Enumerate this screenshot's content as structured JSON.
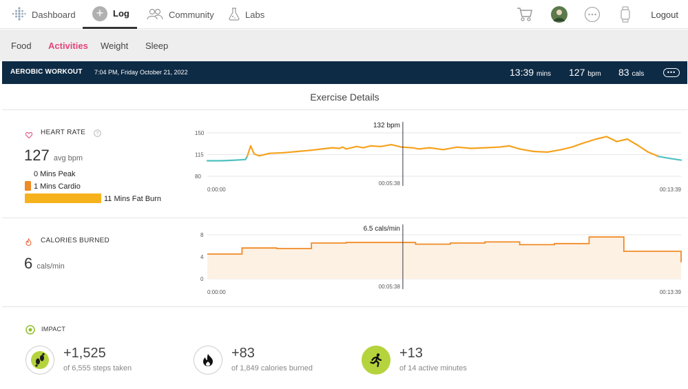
{
  "nav": {
    "dashboard": "Dashboard",
    "log": "Log",
    "community": "Community",
    "labs": "Labs",
    "logout": "Logout",
    "log_icon_glyph": "+"
  },
  "subnav": {
    "items": [
      "Food",
      "Activities",
      "Weight",
      "Sleep"
    ],
    "active": "Activities"
  },
  "workout": {
    "title": "AEROBIC WORKOUT",
    "datetime": "7:04 PM, Friday October 21, 2022",
    "duration_value": "13:39",
    "duration_unit": "mins",
    "bpm_value": "127",
    "bpm_unit": "bpm",
    "cals_value": "83",
    "cals_unit": "cals"
  },
  "section_title": "Exercise Details",
  "heart_rate": {
    "label": "HEART RATE",
    "avg_value": "127",
    "avg_unit": "avg bpm",
    "zones": [
      {
        "text": "0 Mins Peak",
        "minutes": 0
      },
      {
        "text": "1 Mins Cardio",
        "minutes": 1
      },
      {
        "text": "11 Mins Fat Burn",
        "minutes": 11
      }
    ]
  },
  "calories": {
    "label": "CALORIES BURNED",
    "value": "6",
    "unit": "cals/min"
  },
  "impact": {
    "label": "IMPACT",
    "items": [
      {
        "main": "+1,525",
        "sub": "of 6,555 steps taken",
        "icon": "footsteps-icon"
      },
      {
        "main": "+83",
        "sub": "of 1,849 calories burned",
        "icon": "flame-icon"
      },
      {
        "main": "+13",
        "sub": "of 14 active minutes",
        "icon": "runner-icon"
      }
    ]
  },
  "colors": {
    "accent": "#e2437a",
    "header_bg": "#0e2b45",
    "hr_orange": "#f6a21d",
    "hr_teal": "#4fc1c0",
    "cal_orange": "#f08a24",
    "impact_green": "#b5d33d"
  },
  "chart_data": [
    {
      "type": "line",
      "title": "",
      "y_ticks": [
        "150",
        "115",
        "80"
      ],
      "ylim": [
        80,
        150
      ],
      "x_start_label": "0:00:00",
      "x_end_label": "0:00:13:39",
      "x_end_display": "00:13:39",
      "marker_time": "00:05:38",
      "marker_value_label": "132 bpm",
      "x_minutes": [
        0,
        0.4,
        0.8,
        1.1,
        1.15,
        1.25,
        1.35,
        1.5,
        1.8,
        2.2,
        2.6,
        3.0,
        3.3,
        3.6,
        3.8,
        3.9,
        4.0,
        4.3,
        4.5,
        4.7,
        5.0,
        5.3,
        5.6,
        5.9,
        6.1,
        6.4,
        6.8,
        7.2,
        7.6,
        8.0,
        8.4,
        8.7,
        9.0,
        9.4,
        9.8,
        10.2,
        10.5,
        10.8,
        11.2,
        11.5,
        11.8,
        12.1,
        12.4,
        12.7,
        13.0,
        13.3,
        13.65
      ],
      "y_bpm": [
        105,
        105,
        106,
        107,
        112,
        129,
        116,
        113,
        117,
        118,
        120,
        122,
        124,
        126,
        125,
        127,
        124,
        128,
        126,
        129,
        128,
        131,
        127,
        126,
        124,
        126,
        123,
        127,
        125,
        126,
        127,
        129,
        124,
        120,
        119,
        123,
        127,
        133,
        140,
        144,
        136,
        140,
        130,
        119,
        112,
        109,
        106
      ]
    },
    {
      "type": "area",
      "title": "",
      "y_ticks": [
        "8",
        "4",
        "0"
      ],
      "ylim": [
        0,
        8
      ],
      "x_start_label": "0:00:00",
      "x_end_label": "00:13:39",
      "marker_time": "00:05:38",
      "marker_value_label": "6.5 cals/min",
      "steps_minutes": [
        0,
        1,
        2,
        3,
        4,
        5,
        6,
        7,
        8,
        9,
        10,
        11,
        12,
        13,
        13.65
      ],
      "steps_cals": [
        4.5,
        5.6,
        5.5,
        6.5,
        6.6,
        6.6,
        6.3,
        6.5,
        6.7,
        6.2,
        6.4,
        7.6,
        5.0,
        5.0,
        3.0
      ]
    }
  ]
}
